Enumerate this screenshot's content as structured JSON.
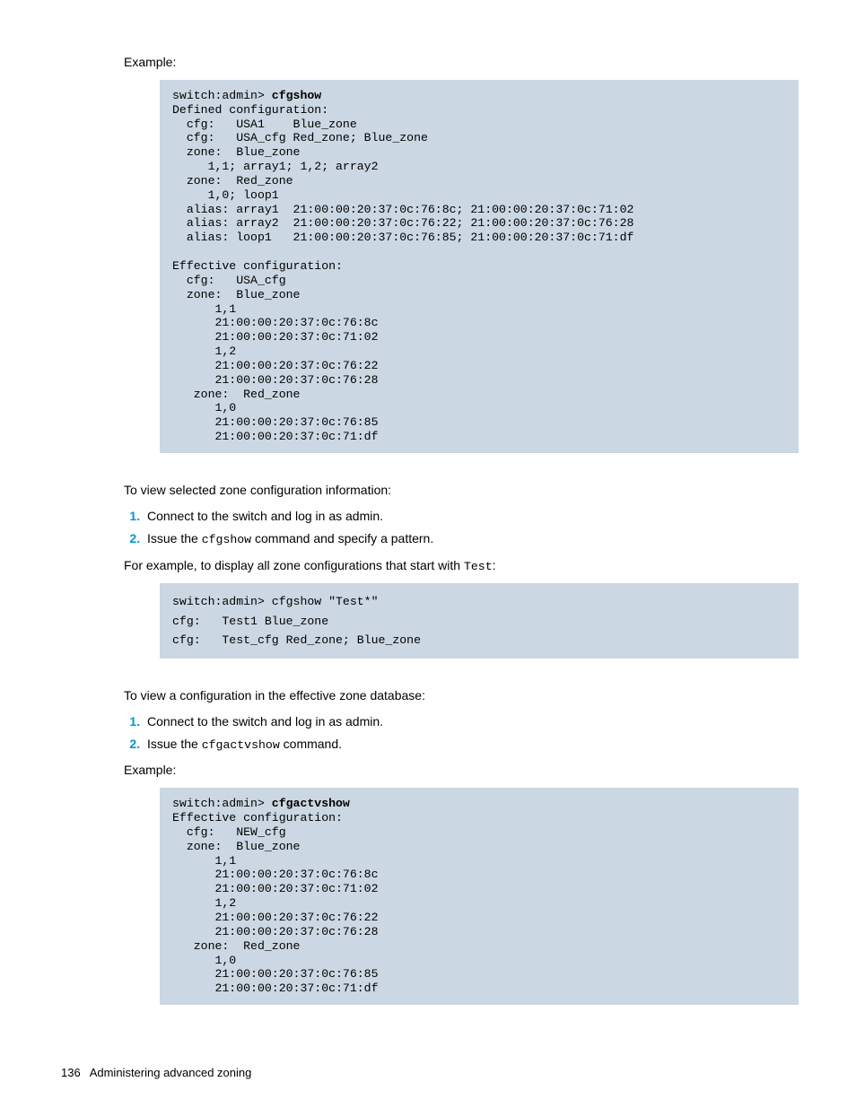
{
  "label_example1": "Example:",
  "code1_prompt": "switch:admin> ",
  "code1_cmd": "cfgshow",
  "code1_body": "Defined configuration:\n  cfg:   USA1    Blue_zone\n  cfg:   USA_cfg Red_zone; Blue_zone\n  zone:  Blue_zone\n     1,1; array1; 1,2; array2\n  zone:  Red_zone\n     1,0; loop1\n  alias: array1  21:00:00:20:37:0c:76:8c; 21:00:00:20:37:0c:71:02\n  alias: array2  21:00:00:20:37:0c:76:22; 21:00:00:20:37:0c:76:28\n  alias: loop1   21:00:00:20:37:0c:76:85; 21:00:00:20:37:0c:71:df\n\nEffective configuration:\n  cfg:   USA_cfg\n  zone:  Blue_zone\n      1,1\n      21:00:00:20:37:0c:76:8c\n      21:00:00:20:37:0c:71:02\n      1,2\n      21:00:00:20:37:0c:76:22\n      21:00:00:20:37:0c:76:28\n   zone:  Red_zone\n      1,0\n      21:00:00:20:37:0c:76:85\n      21:00:00:20:37:0c:71:df",
  "para2": "To view selected zone configuration information:",
  "list1_item1": "Connect to the switch and log in as admin.",
  "list1_item2_a": "Issue the ",
  "list1_item2_code": "cfgshow",
  "list1_item2_b": " command and specify a pattern.",
  "para3_a": "For example, to display all zone configurations that start with ",
  "para3_code": "Test",
  "para3_b": ":",
  "code2": "switch:admin> cfgshow \"Test*\"\ncfg:   Test1 Blue_zone\ncfg:   Test_cfg Red_zone; Blue_zone",
  "para4": "To view a configuration in the effective zone database:",
  "list2_item1": "Connect to the switch and log in as admin.",
  "list2_item2_a": "Issue the ",
  "list2_item2_code": "cfgactvshow",
  "list2_item2_b": " command.",
  "label_example2": "Example:",
  "code3_prompt": "switch:admin> ",
  "code3_cmd": "cfgactvshow",
  "code3_body": "Effective configuration:\n  cfg:   NEW_cfg\n  zone:  Blue_zone\n      1,1\n      21:00:00:20:37:0c:76:8c\n      21:00:00:20:37:0c:71:02\n      1,2\n      21:00:00:20:37:0c:76:22\n      21:00:00:20:37:0c:76:28\n   zone:  Red_zone\n      1,0\n      21:00:00:20:37:0c:76:85\n      21:00:00:20:37:0c:71:df",
  "footer_page": "136",
  "footer_title": "Administering advanced zoning"
}
